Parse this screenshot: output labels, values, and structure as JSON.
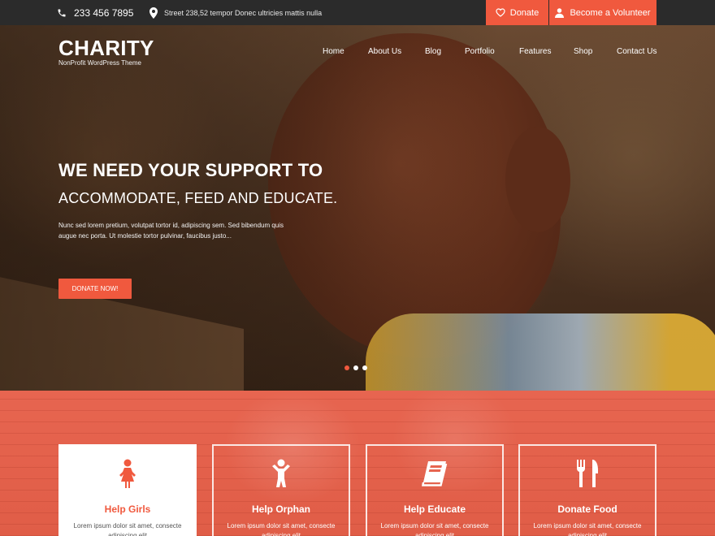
{
  "topbar": {
    "phone": "233 456 7895",
    "address": "Street 238,52 tempor Donec ultricies mattis nulla",
    "donate_label": "Donate",
    "volunteer_label": "Become a Volunteer",
    "icons": [
      "phone-icon",
      "map-pin-icon",
      "heart-icon",
      "user-icon"
    ]
  },
  "brand": {
    "name": "CHARITY",
    "tagline": "NonProfit WordPress Theme"
  },
  "nav": {
    "items": [
      "Home",
      "About Us",
      "Blog",
      "Portfolio",
      "Features",
      "Shop",
      "Contact Us"
    ]
  },
  "hero": {
    "headline": "WE NEED YOUR SUPPORT TO",
    "subheadline": "ACCOMMODATE, FEED AND EDUCATE.",
    "body": "Nunc sed lorem pretium, volutpat tortor id, adipiscing sem. Sed bibendum quis augue nec porta. Ut molestie tortor pulvinar, faucibus justo...",
    "cta_label": "DONATE NOW!",
    "slides": 3,
    "active_slide": 1
  },
  "services": [
    {
      "title": "Help Girls",
      "text": "Lorem ipsum dolor sit amet, consecte adipiscing elit",
      "icon": "girl-icon"
    },
    {
      "title": "Help Orphan",
      "text": "Lorem ipsum dolor sit amet, consecte adipiscing elit",
      "icon": "child-icon"
    },
    {
      "title": "Help Educate",
      "text": "Lorem ipsum dolor sit amet, consecte adipiscing elit",
      "icon": "book-icon"
    },
    {
      "title": "Donate Food",
      "text": "Lorem ipsum dolor sit amet, consecte adipiscing elit",
      "icon": "fork-knife-icon"
    }
  ],
  "colors": {
    "accent": "#f0593e",
    "topbar": "#2b2b2b",
    "services_bg": "#e76550"
  }
}
